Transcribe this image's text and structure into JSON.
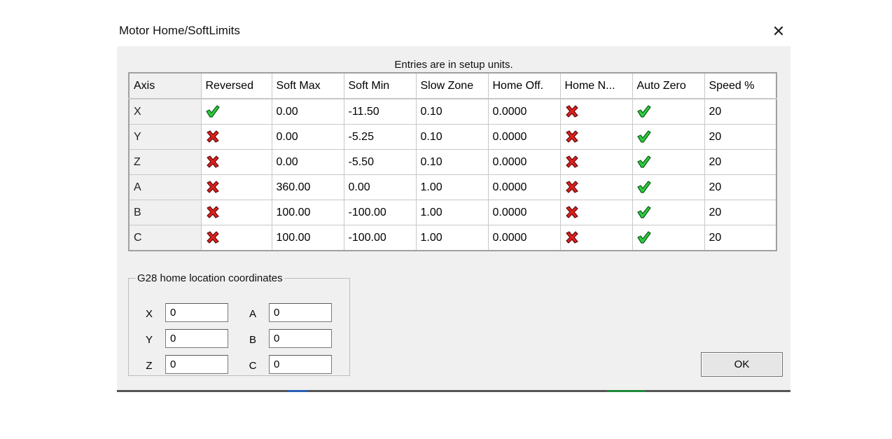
{
  "window": {
    "title": "Motor Home/SoftLimits",
    "close_glyph": "✕"
  },
  "caption": "Entries are in setup units.",
  "table": {
    "columns": [
      "Axis",
      "Reversed",
      "Soft Max",
      "Soft Min",
      "Slow Zone",
      "Home Off.",
      "Home N...",
      "Auto Zero",
      "Speed %"
    ],
    "rows": [
      {
        "axis": "X",
        "reversed": true,
        "soft_max": "0.00",
        "soft_min": "-11.50",
        "slow_zone": "0.10",
        "home_off": "0.0000",
        "home_neg": false,
        "auto_zero": true,
        "speed": "20"
      },
      {
        "axis": "Y",
        "reversed": false,
        "soft_max": "0.00",
        "soft_min": "-5.25",
        "slow_zone": "0.10",
        "home_off": "0.0000",
        "home_neg": false,
        "auto_zero": true,
        "speed": "20"
      },
      {
        "axis": "Z",
        "reversed": false,
        "soft_max": "0.00",
        "soft_min": "-5.50",
        "slow_zone": "0.10",
        "home_off": "0.0000",
        "home_neg": false,
        "auto_zero": true,
        "speed": "20"
      },
      {
        "axis": "A",
        "reversed": false,
        "soft_max": "360.00",
        "soft_min": "0.00",
        "slow_zone": "1.00",
        "home_off": "0.0000",
        "home_neg": false,
        "auto_zero": true,
        "speed": "20"
      },
      {
        "axis": "B",
        "reversed": false,
        "soft_max": "100.00",
        "soft_min": "-100.00",
        "slow_zone": "1.00",
        "home_off": "0.0000",
        "home_neg": false,
        "auto_zero": true,
        "speed": "20"
      },
      {
        "axis": "C",
        "reversed": false,
        "soft_max": "100.00",
        "soft_min": "-100.00",
        "slow_zone": "1.00",
        "home_off": "0.0000",
        "home_neg": false,
        "auto_zero": true,
        "speed": "20"
      }
    ]
  },
  "icons": {
    "true": "green-check-icon",
    "false": "red-x-icon"
  },
  "g28": {
    "legend": "G28 home location coordinates",
    "fields": {
      "x": {
        "label": "X",
        "value": "0"
      },
      "y": {
        "label": "Y",
        "value": "0"
      },
      "z": {
        "label": "Z",
        "value": "0"
      },
      "a": {
        "label": "A",
        "value": "0"
      },
      "b": {
        "label": "B",
        "value": "0"
      },
      "c": {
        "label": "C",
        "value": "0"
      }
    }
  },
  "ok_label": "OK",
  "colors": {
    "check_fill": "#2ecc40",
    "check_stroke": "#0a5a14",
    "x_fill": "#e0201c",
    "x_stroke": "#5a0a0a",
    "dialog_bg": "#f0f0f0"
  }
}
